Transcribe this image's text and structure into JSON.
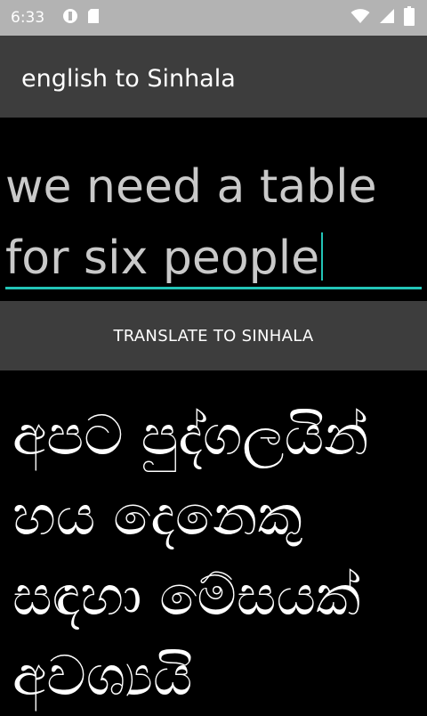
{
  "status_bar": {
    "time": "6:33",
    "left_icons": [
      "circle-badge-icon",
      "sim-card-icon"
    ],
    "right_icons": [
      "wifi-icon",
      "cell-signal-icon",
      "battery-icon"
    ],
    "background": "#b3b3b3"
  },
  "app_bar": {
    "title": "english to Sinhala",
    "background": "#3d3d3d"
  },
  "input": {
    "value": "we need a table for six people",
    "accent": "#23c4b7"
  },
  "translate_button": {
    "label": "TRANSLATE TO SINHALA"
  },
  "output": {
    "text": "අපට පුද්ගලයින් හය දෙනෙකු සඳහා මේසයක් අවශ්‍යයි"
  }
}
